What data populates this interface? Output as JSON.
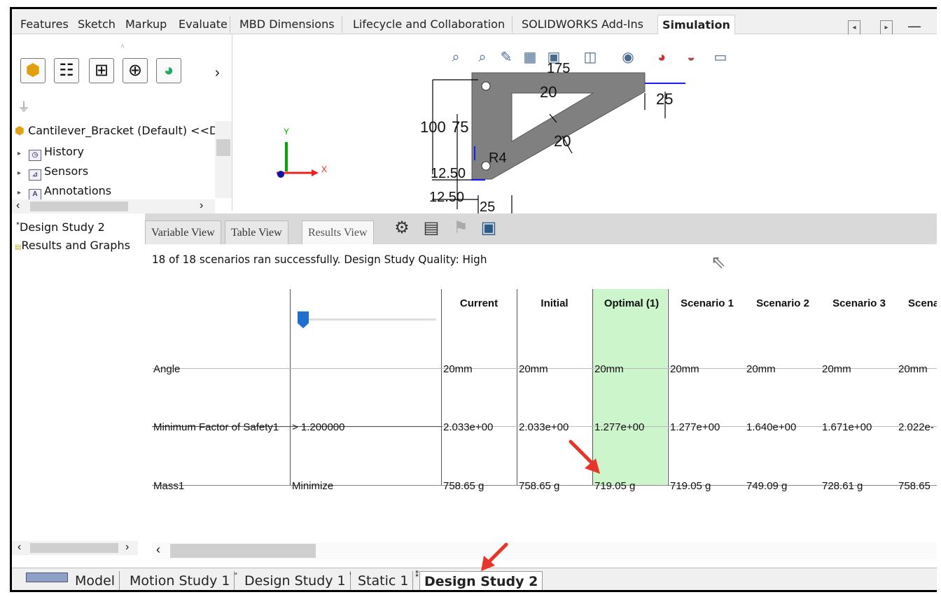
{
  "command_tabs": [
    "Features",
    "Sketch",
    "Markup",
    "Evaluate",
    "MBD Dimensions",
    "Lifecycle and Collaboration",
    "SOLIDWORKS Add-Ins",
    "Simulation"
  ],
  "feature_tree": {
    "root": "Cantilever_Bracket (Default) <<D",
    "items": [
      "History",
      "Sensors",
      "Annotations"
    ]
  },
  "dimensions": {
    "d175": "175",
    "d20a": "20",
    "d25a": "25",
    "d100": "100",
    "d75": "75",
    "d20b": "20",
    "r4": "R4",
    "d1250a": "12.50",
    "d1250b": "12.50",
    "d25b": "25"
  },
  "triad": {
    "x": "X",
    "y": "Y"
  },
  "study_tree": {
    "study": "Design Study 2",
    "results": "Results and Graphs"
  },
  "study_tabs": [
    "Variable View",
    "Table View",
    "Results View"
  ],
  "status_message": "18 of 18 scenarios ran successfully. Design Study Quality: High",
  "results_table": {
    "columns": [
      "Current",
      "Initial",
      "Optimal (1)",
      "Scenario 1",
      "Scenario 2",
      "Scenario 3",
      "Scena"
    ],
    "rows": [
      {
        "name": "Angle",
        "condition": "",
        "values": [
          "20mm",
          "20mm",
          "20mm",
          "20mm",
          "20mm",
          "20mm",
          "20mm"
        ]
      },
      {
        "name": "Minimum Factor of Safety1",
        "condition": "> 1.200000",
        "values": [
          "2.033e+00",
          "2.033e+00",
          "1.277e+00",
          "1.277e+00",
          "1.640e+00",
          "1.671e+00",
          "2.022e-"
        ]
      },
      {
        "name": "Mass1",
        "condition": "Minimize",
        "values": [
          "758.65 g",
          "758.65 g",
          "719.05 g",
          "719.05 g",
          "749.09 g",
          "728.61 g",
          "758.65"
        ]
      }
    ],
    "highlight_color": "#ccf5cc"
  },
  "bottom_tabs": [
    "Model",
    "Motion Study 1",
    "Design Study 1",
    "Static 1",
    "Design Study 2"
  ],
  "accent_color": "#e8352a"
}
